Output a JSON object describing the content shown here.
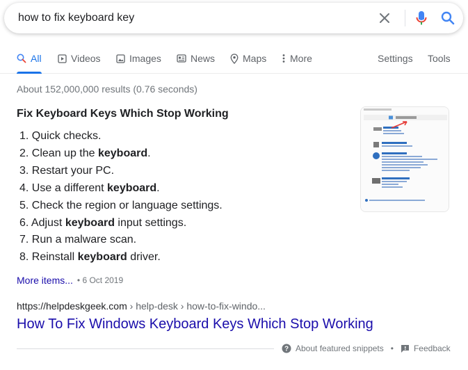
{
  "search": {
    "query": "how to fix keyboard key"
  },
  "tabs": [
    {
      "label": "All",
      "icon": "search-icon",
      "active": true
    },
    {
      "label": "Videos",
      "icon": "video-icon"
    },
    {
      "label": "Images",
      "icon": "image-icon"
    },
    {
      "label": "News",
      "icon": "news-icon"
    },
    {
      "label": "Maps",
      "icon": "map-pin-icon"
    },
    {
      "label": "More",
      "icon": "more-vertical-icon"
    }
  ],
  "tools": {
    "settings_label": "Settings",
    "tools_label": "Tools"
  },
  "stats": "About 152,000,000 results (0.76 seconds)",
  "snippet": {
    "title": "Fix Keyboard Keys Which Stop Working",
    "items": [
      {
        "num": "1.",
        "text": "Quick checks.",
        "bold": ""
      },
      {
        "num": "2.",
        "text": "Clean up the ",
        "bold": "keyboard",
        "after": "."
      },
      {
        "num": "3.",
        "text": "Restart your PC.",
        "bold": ""
      },
      {
        "num": "4.",
        "text": "Use a different ",
        "bold": "keyboard",
        "after": "."
      },
      {
        "num": "5.",
        "text": "Check the region or language settings.",
        "bold": ""
      },
      {
        "num": "6.",
        "text": "Adjust ",
        "bold": "keyboard",
        "after": " input settings."
      },
      {
        "num": "7.",
        "text": "Run a malware scan.",
        "bold": ""
      },
      {
        "num": "8.",
        "text": "Reinstall ",
        "bold": "keyboard",
        "after": " driver."
      }
    ],
    "more_items_label": "More items...",
    "date": "6 Oct 2019",
    "thumbnail_icon": "control-panel-screenshot"
  },
  "result": {
    "domain": "https://helpdeskgeek.com",
    "path": " › help-desk › how-to-fix-windo...",
    "title": "How To Fix Windows Keyboard Keys Which Stop Working"
  },
  "footer": {
    "about_label": "About featured snippets",
    "separator": "•",
    "feedback_label": "Feedback"
  },
  "colors": {
    "link": "#1a0dab",
    "active_tab": "#1a73e8",
    "mic_blue": "#4285f4",
    "mic_red": "#ea4335",
    "mic_yellow": "#fbbc04",
    "mic_green": "#34a853"
  }
}
